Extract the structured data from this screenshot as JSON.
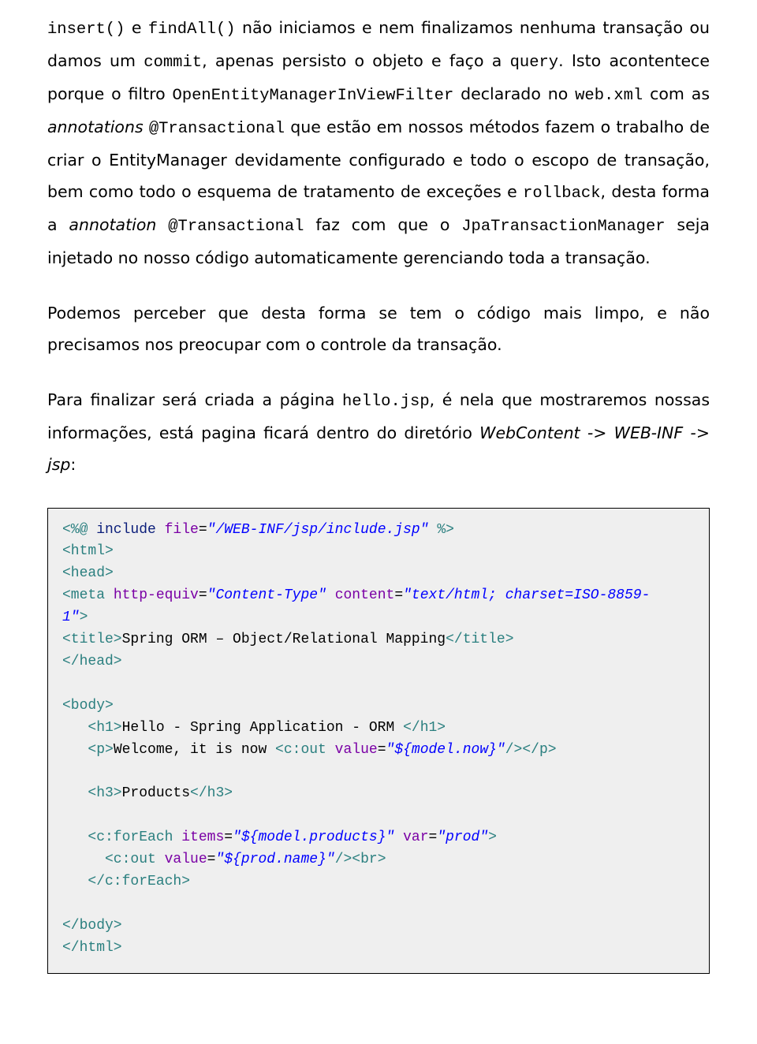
{
  "body": {
    "p1_a": "insert()",
    "p1_b": " e ",
    "p1_c": "findAll()",
    "p1_d": " não iniciamos e nem finalizamos nenhuma transação ou damos um ",
    "p1_e": "commit",
    "p1_f": ", apenas persisto o objeto e faço a ",
    "p1_g": "query",
    "p1_h": ". Isto acontentece porque o filtro ",
    "p1_i": "OpenEntityManagerInViewFilter",
    "p1_j": " declarado no ",
    "p1_k": "web.xml",
    "p1_l": " com as ",
    "p1_m": "annotations",
    "p1_n": " ",
    "p1_o": "@Transactional",
    "p1_p": " que estão em nossos métodos fazem o trabalho de criar o EntityManager devidamente configurado e todo o escopo de transação, bem como todo o esquema de tratamento de exceções e ",
    "p1_q": "rollback",
    "p1_r": ", desta forma a ",
    "p1_s": "annotation",
    "p1_t": " ",
    "p1_u": "@Transactional",
    "p1_v": " faz com que o ",
    "p1_w": "JpaTransactionManager",
    "p1_x": " seja injetado no nosso código automaticamente gerenciando toda a transação.",
    "p2": "Podemos perceber que desta forma se tem o código mais limpo, e não precisamos nos preocupar com o controle da transação.",
    "p3_a": "Para finalizar será criada a página ",
    "p3_b": "hello.jsp",
    "p3_c": ", é nela que mostraremos nossas informações, está pagina ficará dentro do diretório ",
    "p3_d": "WebContent -> WEB-INF -> jsp",
    "p3_e": ":"
  },
  "code": {
    "l1_a": "<%@",
    "l1_b": " include ",
    "l1_c": "file",
    "l1_d": "=",
    "l1_e": "\"/WEB-INF/jsp/include.jsp\"",
    "l1_f": " %>",
    "l2": "<html>",
    "l3": "<head>",
    "l4_a": "<meta ",
    "l4_b": "http-equiv",
    "l4_c": "=",
    "l4_d": "\"Content-Type\"",
    "l4_e": " content",
    "l4_f": "=",
    "l4_g": "\"text/html; charset=ISO-8859-",
    "l4_h": "1\"",
    "l4_i": ">",
    "l5_a": "<title>",
    "l5_b": "Spring ORM – Object/Relational Mapping",
    "l5_c": "</title>",
    "l6": "</head>",
    "l7": "<body>",
    "l8_a": "   <h1>",
    "l8_b": "Hello - Spring Application - ORM ",
    "l8_c": "</h1>",
    "l9_a": "   <p>",
    "l9_b": "Welcome, it is now ",
    "l9_c": "<c:out ",
    "l9_d": "value",
    "l9_e": "=",
    "l9_f": "\"${model.now}\"",
    "l9_g": "/></p>",
    "l10_a": "   <h3>",
    "l10_b": "Products",
    "l10_c": "</h3>",
    "l11_a": "   <c:forEach ",
    "l11_b": "items",
    "l11_c": "=",
    "l11_d": "\"${model.products}\"",
    "l11_e": " var",
    "l11_f": "=",
    "l11_g": "\"prod\"",
    "l11_h": ">",
    "l12_a": "     <c:out ",
    "l12_b": "value",
    "l12_c": "=",
    "l12_d": "\"${prod.name}\"",
    "l12_e": "/><br>",
    "l13": "   </c:forEach>",
    "l14": "</body>",
    "l15": "</html>"
  }
}
